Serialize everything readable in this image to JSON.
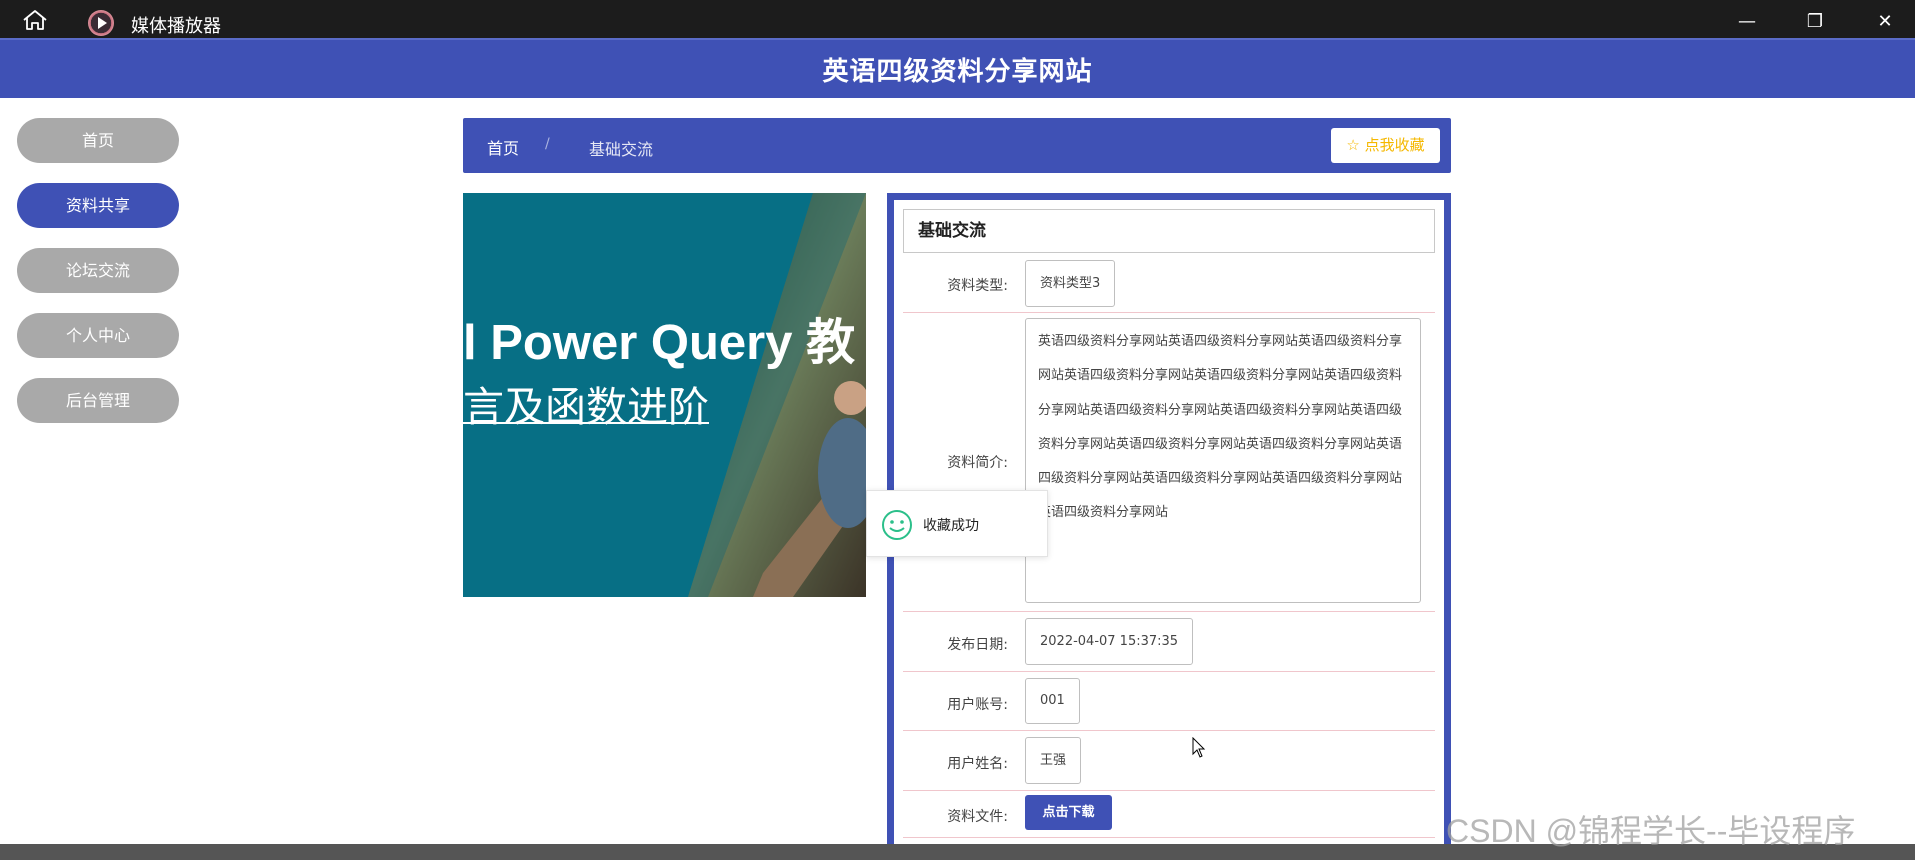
{
  "window": {
    "app_title": "媒体播放器",
    "minimize": "—",
    "maximize": "❐",
    "close": "✕"
  },
  "site": {
    "title": "英语四级资料分享网站"
  },
  "sidebar": {
    "items": [
      {
        "label": "首页",
        "active": false
      },
      {
        "label": "资料共享",
        "active": true
      },
      {
        "label": "论坛交流",
        "active": false
      },
      {
        "label": "个人中心",
        "active": false
      },
      {
        "label": "后台管理",
        "active": false
      }
    ]
  },
  "breadcrumb": {
    "home": "首页",
    "separator": "/",
    "current": "基础交流",
    "favorite_button": "☆ 点我收藏"
  },
  "banner": {
    "line1": "l Power Query 教",
    "line2": "言及函数进阶"
  },
  "detail": {
    "title": "基础交流",
    "fields": {
      "type_label": "资料类型:",
      "type_value": "资料类型3",
      "intro_label": "资料简介:",
      "intro_value": "英语四级资料分享网站英语四级资料分享网站英语四级资料分享网站英语四级资料分享网站英语四级资料分享网站英语四级资料分享网站英语四级资料分享网站英语四级资料分享网站英语四级资料分享网站英语四级资料分享网站英语四级资料分享网站英语四级资料分享网站英语四级资料分享网站英语四级资料分享网站英语四级资料分享网站",
      "date_label": "发布日期:",
      "date_value": "2022-04-07 15:37:35",
      "account_label": "用户账号:",
      "account_value": "001",
      "name_label": "用户姓名:",
      "name_value": "王强",
      "file_label": "资料文件:",
      "download_button": "点击下载"
    }
  },
  "toast": {
    "message": "收藏成功"
  },
  "watermark": "CSDN @锦程学长--毕设程序",
  "colors": {
    "primary": "#3f51b5",
    "nav_inactive": "#a9a9a9",
    "favorite": "#f5b800",
    "toast_icon": "#2bbf8a"
  }
}
